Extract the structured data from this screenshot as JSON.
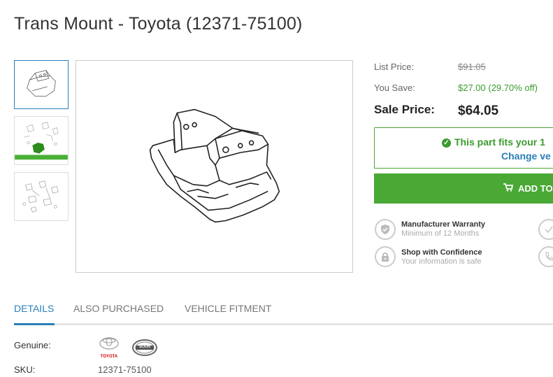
{
  "product": {
    "title": "Trans Mount - Toyota (12371-75100)"
  },
  "pricing": {
    "list_label": "List Price:",
    "list_value": "$91.05",
    "save_label": "You Save:",
    "save_value": "$27.00 (29.70% off)",
    "sale_label": "Sale Price:",
    "sale_value": "$64.05"
  },
  "fitment": {
    "status_text": "This part fits your 1",
    "change_link": "Change ve"
  },
  "cart": {
    "button_label": "ADD TO"
  },
  "features": [
    {
      "title": "Manufacturer Warranty",
      "subtitle": "Minimum of 12 Months",
      "icon": "shield-check-icon"
    },
    {
      "title": "Shop with Confidence",
      "subtitle": "Your information is safe",
      "icon": "lock-icon"
    }
  ],
  "tabs": [
    {
      "label": "DETAILS",
      "active": true
    },
    {
      "label": "ALSO PURCHASED",
      "active": false
    },
    {
      "label": "VEHICLE FITMENT",
      "active": false
    }
  ],
  "details": {
    "genuine_label": "Genuine:",
    "toyota_logo_text": "TOYOTA",
    "scion_logo_text": "SCION",
    "sku_label": "SKU:",
    "sku_value": "12371-75100"
  },
  "colors": {
    "accent_blue": "#2a7fb8",
    "accent_green": "#4aa934",
    "price_green": "#3a9b2d"
  }
}
